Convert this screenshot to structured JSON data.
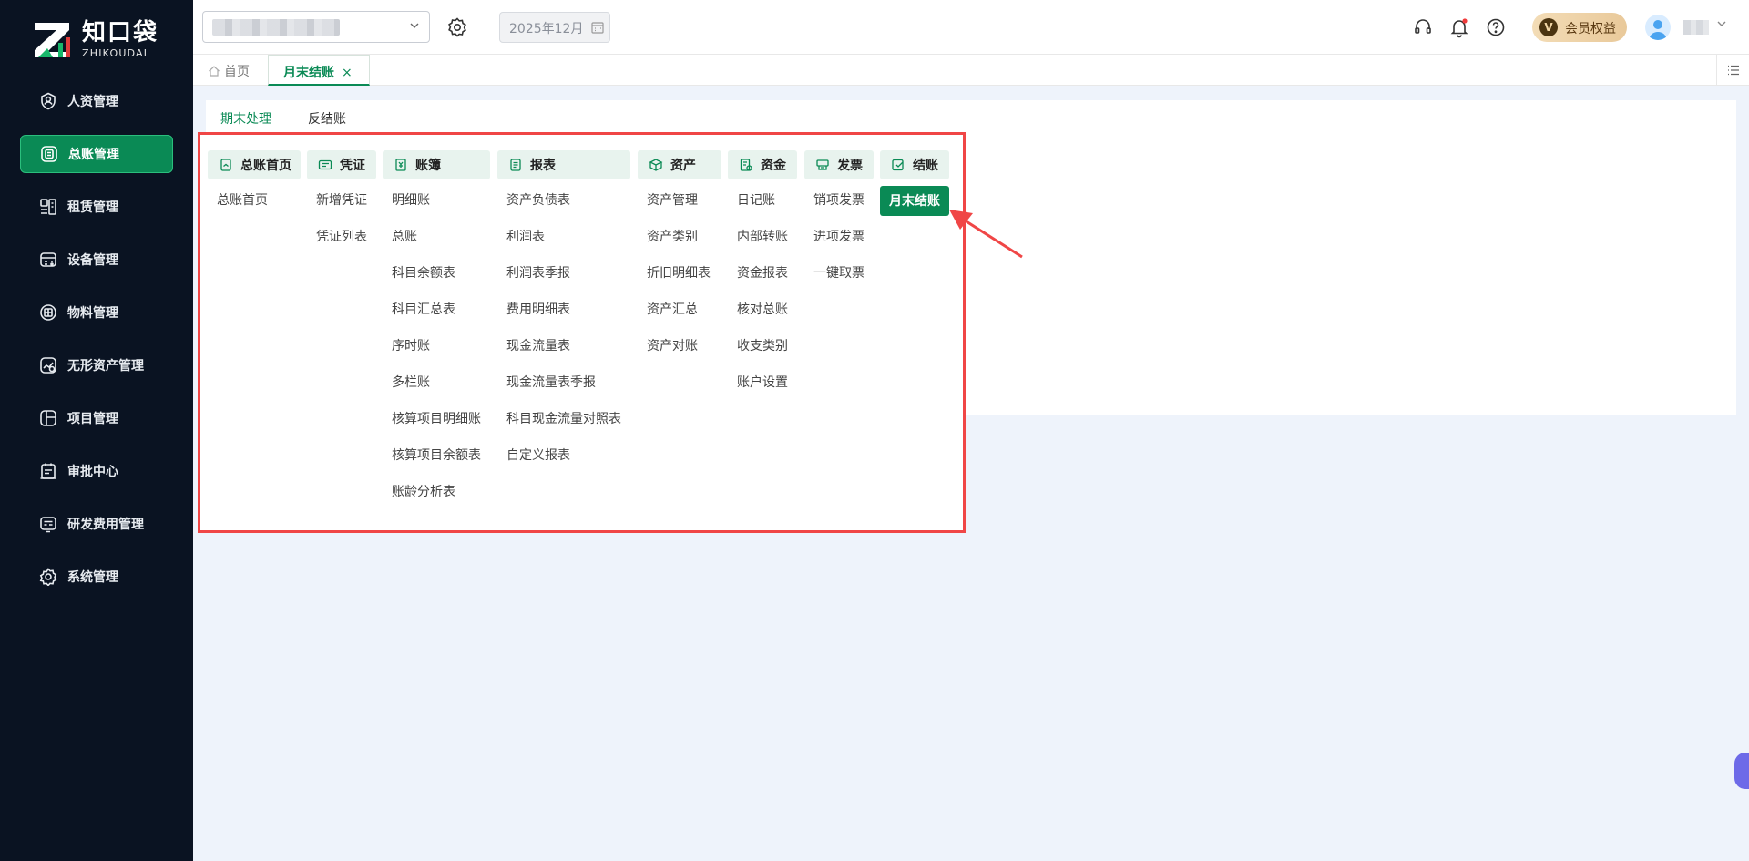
{
  "brand": {
    "name_cn": "知口袋",
    "name_en": "ZHIKOUDAI",
    "accent": "#0a8a55",
    "sidebar_bg": "#0a1322"
  },
  "sidebar": {
    "items": [
      {
        "label": "人资管理",
        "icon": "person-badge-icon"
      },
      {
        "label": "总账管理",
        "icon": "ledger-icon",
        "active": true
      },
      {
        "label": "租赁管理",
        "icon": "lease-icon"
      },
      {
        "label": "设备管理",
        "icon": "device-icon"
      },
      {
        "label": "物料管理",
        "icon": "box-icon"
      },
      {
        "label": "无形资产管理",
        "icon": "chart-icon"
      },
      {
        "label": "项目管理",
        "icon": "project-icon"
      },
      {
        "label": "审批中心",
        "icon": "approval-icon"
      },
      {
        "label": "研发费用管理",
        "icon": "rd-icon"
      },
      {
        "label": "系统管理",
        "icon": "gear-icon"
      }
    ]
  },
  "header": {
    "period": "2025年12月",
    "vip_label": "会员权益",
    "vip_badge": "V"
  },
  "tabs": {
    "home": "首页",
    "active": "月末结账",
    "close": "×"
  },
  "subtabs": [
    "期末处理",
    "反结账"
  ],
  "menu": {
    "columns": [
      {
        "title": "总账首页",
        "items": [
          "总账首页"
        ]
      },
      {
        "title": "凭证",
        "items": [
          "新增凭证",
          "凭证列表"
        ]
      },
      {
        "title": "账簿",
        "items": [
          "明细账",
          "总账",
          "科目余额表",
          "科目汇总表",
          "序时账",
          "多栏账",
          "核算项目明细账",
          "核算项目余额表",
          "账龄分析表"
        ]
      },
      {
        "title": "报表",
        "items": [
          "资产负债表",
          "利润表",
          "利润表季报",
          "费用明细表",
          "现金流量表",
          "现金流量表季报",
          "科目现金流量对照表",
          "自定义报表"
        ]
      },
      {
        "title": "资产",
        "items": [
          "资产管理",
          "资产类别",
          "折旧明细表",
          "资产汇总",
          "资产对账"
        ]
      },
      {
        "title": "资金",
        "items": [
          "日记账",
          "内部转账",
          "资金报表",
          "核对总账",
          "收支类别",
          "账户设置"
        ]
      },
      {
        "title": "发票",
        "items": [
          "销项发票",
          "进项发票",
          "一键取票"
        ]
      },
      {
        "title": "结账",
        "items": [
          "月末结账"
        ],
        "selected": "月末结账"
      }
    ]
  }
}
